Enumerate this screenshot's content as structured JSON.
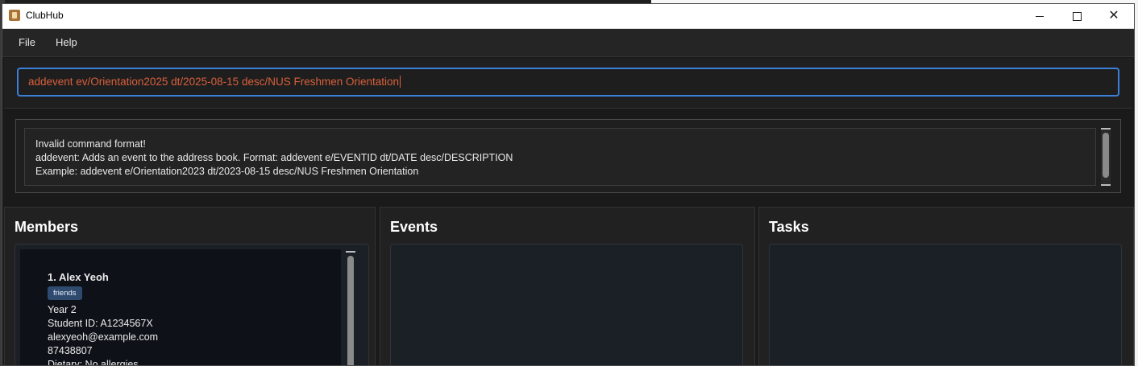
{
  "window": {
    "title": "ClubHub"
  },
  "menu": {
    "file": "File",
    "help": "Help"
  },
  "command": {
    "value": "addevent ev/Orientation2025 dt/2025-08-15 desc/NUS Freshmen Orientation"
  },
  "result": {
    "line1": "Invalid command format!",
    "line2": "addevent: Adds an event to the address book. Format: addevent e/EVENTID dt/DATE desc/DESCRIPTION",
    "line3": "Example: addevent e/Orientation2023 dt/2023-08-15 desc/NUS Freshmen Orientation"
  },
  "panels": {
    "members": {
      "title": "Members"
    },
    "events": {
      "title": "Events"
    },
    "tasks": {
      "title": "Tasks"
    }
  },
  "members": [
    {
      "name": "1.  Alex Yeoh",
      "tag": "friends",
      "year": "Year 2",
      "student_id": "Student ID: A1234567X",
      "email": "alexyeoh@example.com",
      "phone": "87438807",
      "dietary": "Dietary: No allergies"
    }
  ],
  "colors": {
    "accent": "#3b7fd8",
    "command_text": "#d9603c",
    "tag_bg": "#2e4a6e"
  }
}
